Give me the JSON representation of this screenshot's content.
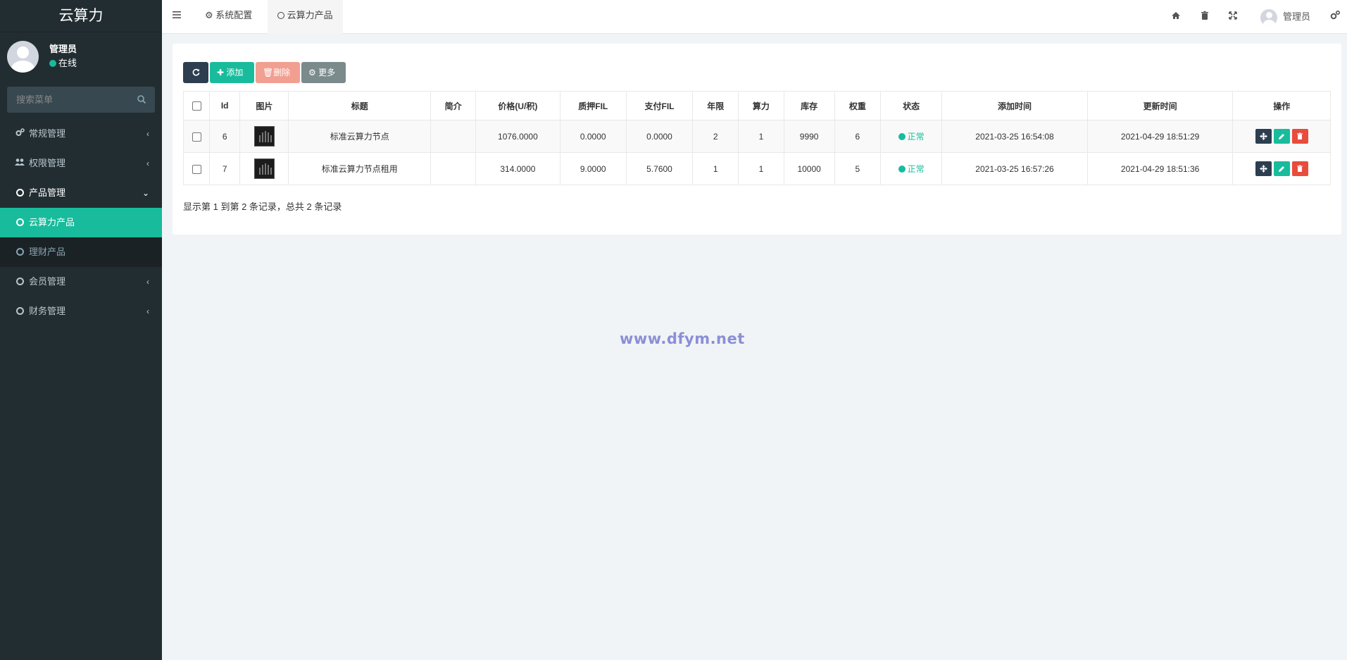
{
  "app": {
    "logo": "云算力"
  },
  "user": {
    "name": "管理员",
    "status": "在线"
  },
  "search": {
    "placeholder": "搜索菜单"
  },
  "menu": [
    {
      "label": "常规管理",
      "icon": "cogs-icon"
    },
    {
      "label": "权限管理",
      "icon": "users-icon"
    },
    {
      "label": "产品管理",
      "icon": "circle-icon"
    },
    {
      "label": "云算力产品",
      "icon": "circle-icon"
    },
    {
      "label": "理财产品",
      "icon": "circle-icon"
    },
    {
      "label": "会员管理",
      "icon": "circle-icon"
    },
    {
      "label": "财务管理",
      "icon": "circle-icon"
    }
  ],
  "navbar": {
    "tabs": [
      {
        "label": "系统配置"
      },
      {
        "label": "云算力产品"
      }
    ],
    "user_name": "管理员"
  },
  "toolbar": {
    "add_label": "添加",
    "delete_label": "删除",
    "more_label": "更多"
  },
  "table": {
    "columns": [
      "Id",
      "图片",
      "标题",
      "简介",
      "价格(U/积)",
      "质押FIL",
      "支付FIL",
      "年限",
      "算力",
      "库存",
      "权重",
      "状态",
      "添加时间",
      "更新时间",
      "操作"
    ],
    "rows": [
      {
        "id": "6",
        "title": "标准云算力节点",
        "intro": "",
        "price": "1076.0000",
        "pledge": "0.0000",
        "pay": "0.0000",
        "years": "2",
        "power": "1",
        "stock": "9990",
        "weight": "6",
        "status": "正常",
        "created": "2021-03-25 16:54:08",
        "updated": "2021-04-29 18:51:29"
      },
      {
        "id": "7",
        "title": "标准云算力节点租用",
        "intro": "",
        "price": "314.0000",
        "pledge": "9.0000",
        "pay": "5.7600",
        "years": "1",
        "power": "1",
        "stock": "10000",
        "weight": "5",
        "status": "正常",
        "created": "2021-03-25 16:57:26",
        "updated": "2021-04-29 18:51:36"
      }
    ]
  },
  "summary": "显示第 1 到第 2 条记录，总共 2 条记录",
  "watermark": "www.dfym.net",
  "colors": {
    "sidebar": "#222d32",
    "accent": "#18bc9c",
    "danger": "#e74c3c",
    "dark_button": "#2c3e50"
  }
}
